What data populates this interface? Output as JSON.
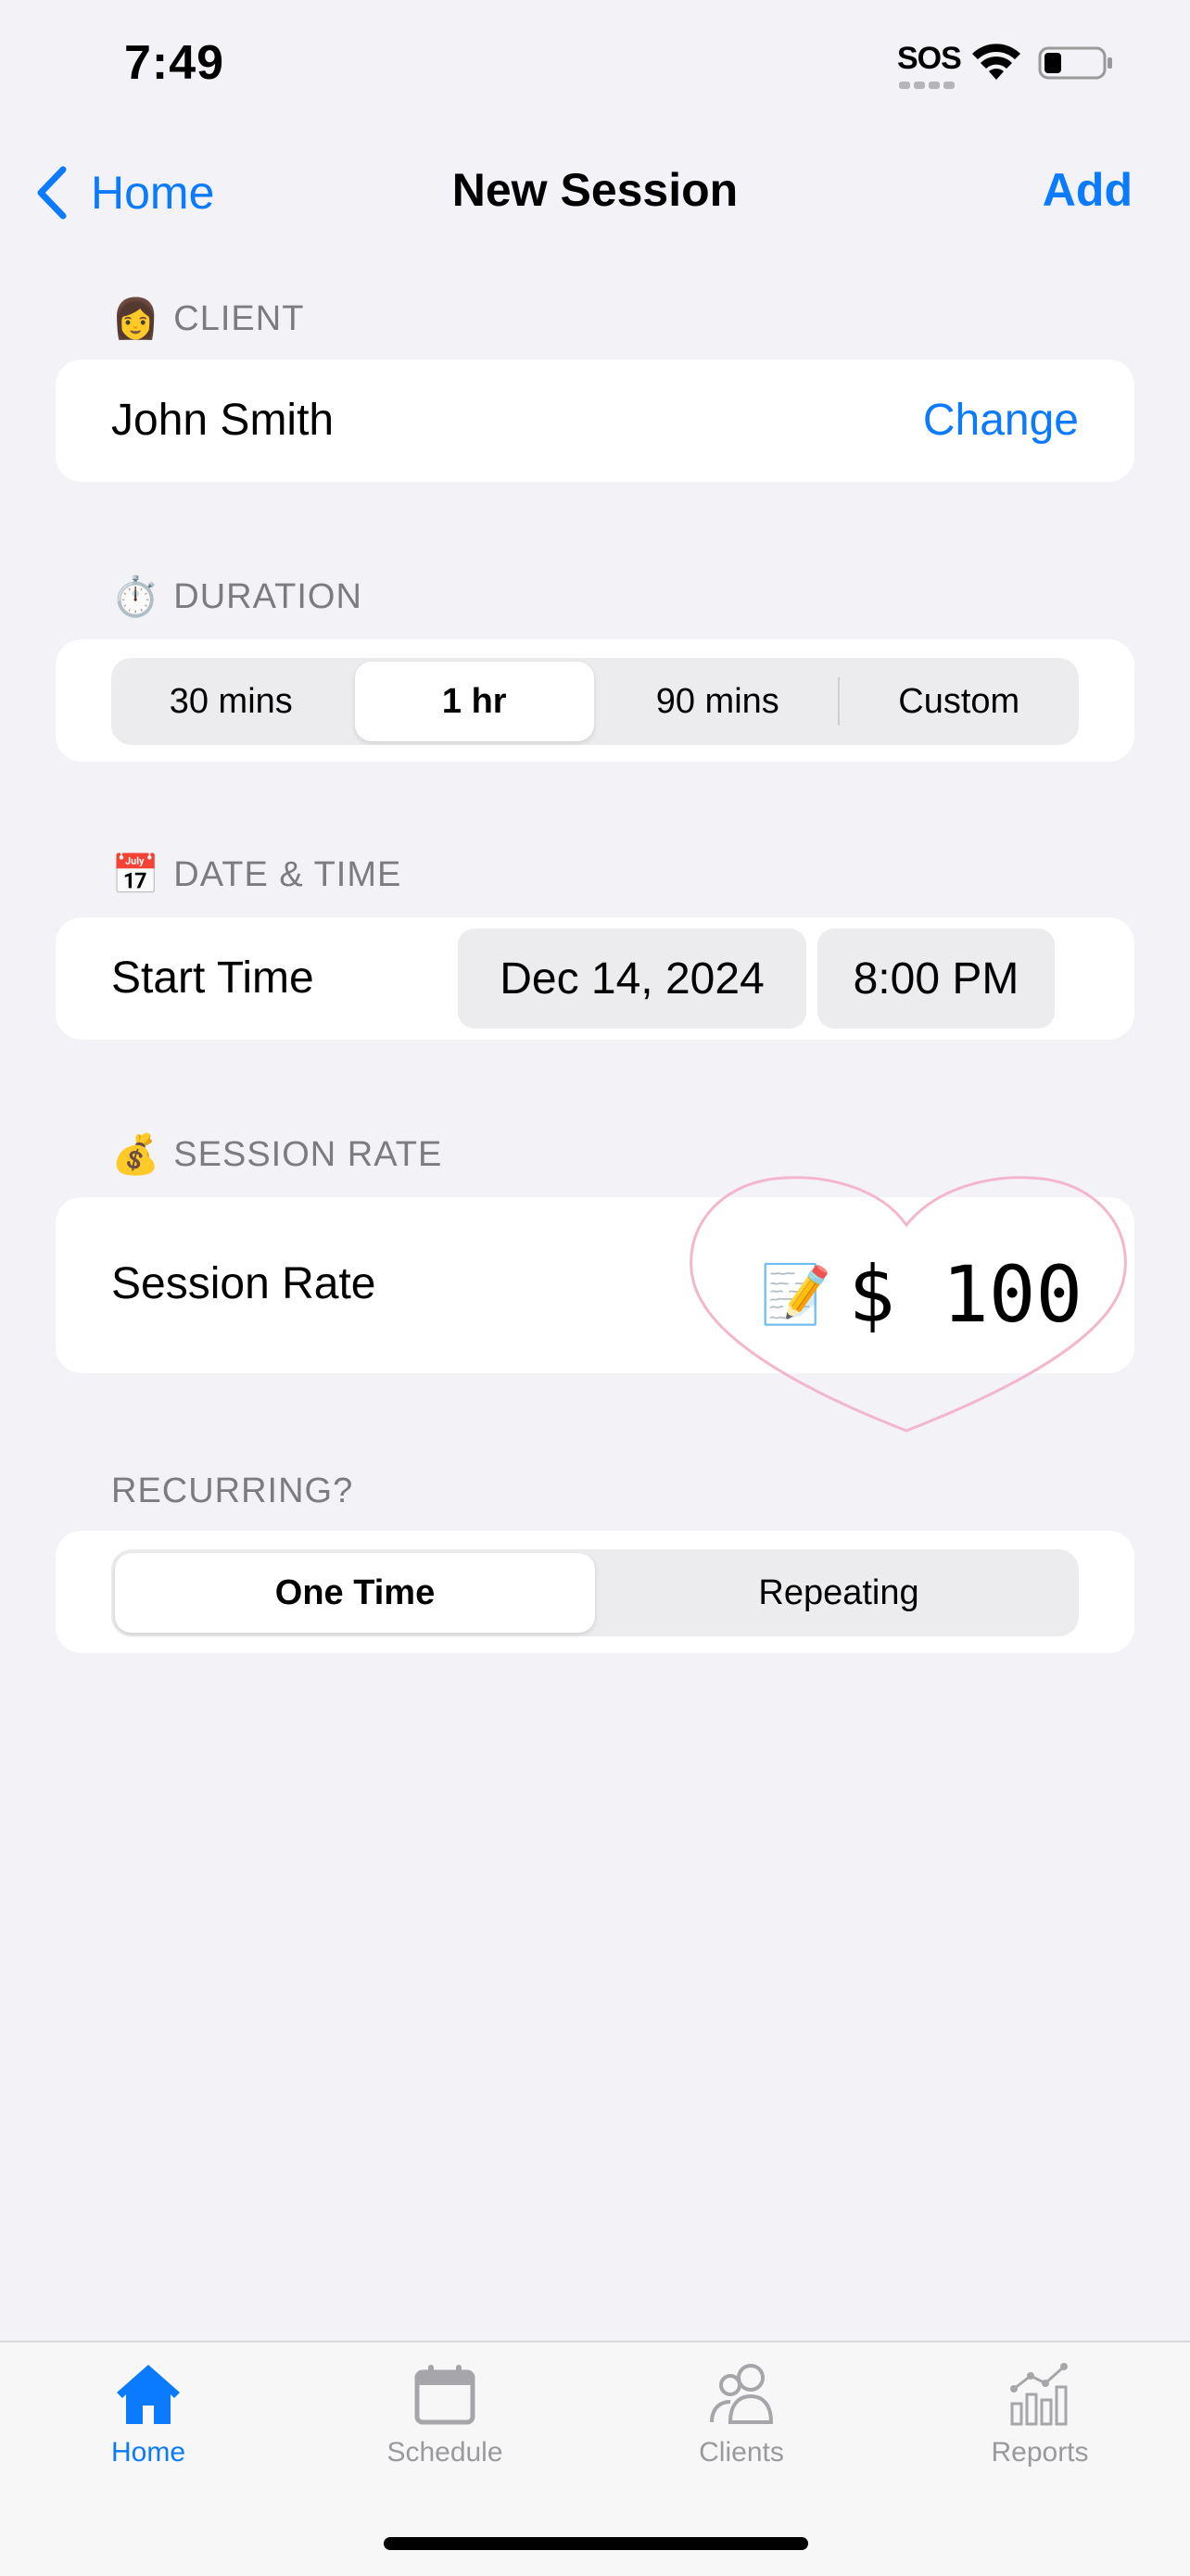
{
  "status_bar": {
    "time": "7:49",
    "sos": "SOS"
  },
  "nav": {
    "back_label": "Home",
    "title": "New Session",
    "action_label": "Add"
  },
  "client": {
    "header": "CLIENT",
    "header_emoji": "👩",
    "name": "John Smith",
    "change_label": "Change"
  },
  "duration": {
    "header": "DURATION",
    "header_emoji": "⏱️",
    "options": [
      "30 mins",
      "1 hr",
      "90 mins",
      "Custom"
    ],
    "selected": "1 hr"
  },
  "datetime": {
    "header": "DATE & TIME",
    "header_emoji": "📅",
    "label": "Start Time",
    "date": "Dec 14, 2024",
    "time": "8:00 PM"
  },
  "rate": {
    "header": "SESSION RATE",
    "header_emoji": "💰",
    "label": "Session Rate",
    "value": "$ 100",
    "edit_icon": "📝"
  },
  "recurring": {
    "header": "RECURRING?",
    "options": [
      "One Time",
      "Repeating"
    ],
    "selected": "One Time"
  },
  "tabs": [
    {
      "label": "Home",
      "icon": "house-icon",
      "active": true
    },
    {
      "label": "Schedule",
      "icon": "calendar-icon",
      "active": false
    },
    {
      "label": "Clients",
      "icon": "people-icon",
      "active": false
    },
    {
      "label": "Reports",
      "icon": "chart-icon",
      "active": false
    }
  ],
  "colors": {
    "accent": "#0a7aff",
    "background": "#f2f2f7",
    "card": "#ffffff",
    "heart_outline": "#f4b6cc"
  }
}
